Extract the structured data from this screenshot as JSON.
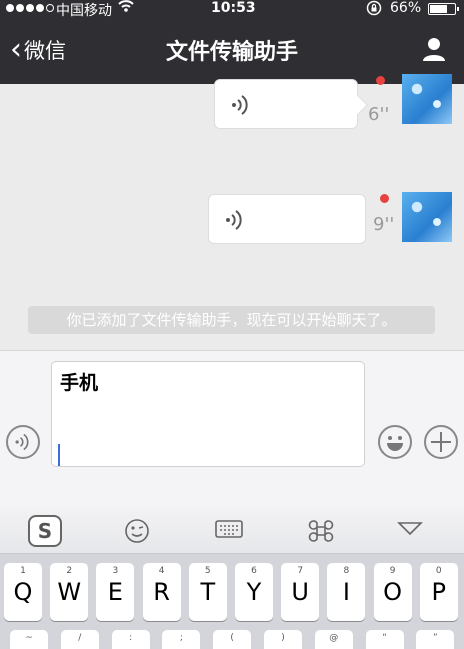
{
  "status_bar": {
    "carrier": "中国移动",
    "time": "10:53",
    "battery_percent": "66%",
    "battery_level": 0.66,
    "signal_bars_filled": 4,
    "icons": [
      "signal-dots-icon",
      "wifi-icon",
      "rotation-lock-icon",
      "battery-icon"
    ]
  },
  "nav": {
    "back_label": "微信",
    "title": "文件传输助手",
    "right_icon": "person-icon"
  },
  "messages": [
    {
      "type": "voice",
      "duration": "6''",
      "unread": true
    },
    {
      "type": "voice",
      "duration": "9''",
      "unread": true
    }
  ],
  "system_message": "你已添加了文件传输助手，现在可以开始聊天了。",
  "input": {
    "value": "手机",
    "left_icon": "voice-icon",
    "right_icons": [
      "emoji-icon",
      "plus-icon"
    ]
  },
  "keyboard": {
    "toolbar_icons": [
      "sogou-logo-icon",
      "emoji-wink-icon",
      "keyboard-icon",
      "command-icon",
      "collapse-icon"
    ],
    "row1": [
      {
        "main": "Q",
        "sub": "1"
      },
      {
        "main": "W",
        "sub": "2"
      },
      {
        "main": "E",
        "sub": "3"
      },
      {
        "main": "R",
        "sub": "4"
      },
      {
        "main": "T",
        "sub": "5"
      },
      {
        "main": "Y",
        "sub": "6"
      },
      {
        "main": "U",
        "sub": "7"
      },
      {
        "main": "I",
        "sub": "8"
      },
      {
        "main": "O",
        "sub": "9"
      },
      {
        "main": "P",
        "sub": "0"
      }
    ],
    "row2_subs": [
      "~",
      "/",
      ":",
      ";",
      "(",
      ")",
      "@",
      "“",
      "”"
    ]
  },
  "colors": {
    "nav_bg": "#2e2e33",
    "chat_bg": "#ebebeb",
    "unread_dot": "#e64340",
    "caret": "#3d6fd9"
  }
}
